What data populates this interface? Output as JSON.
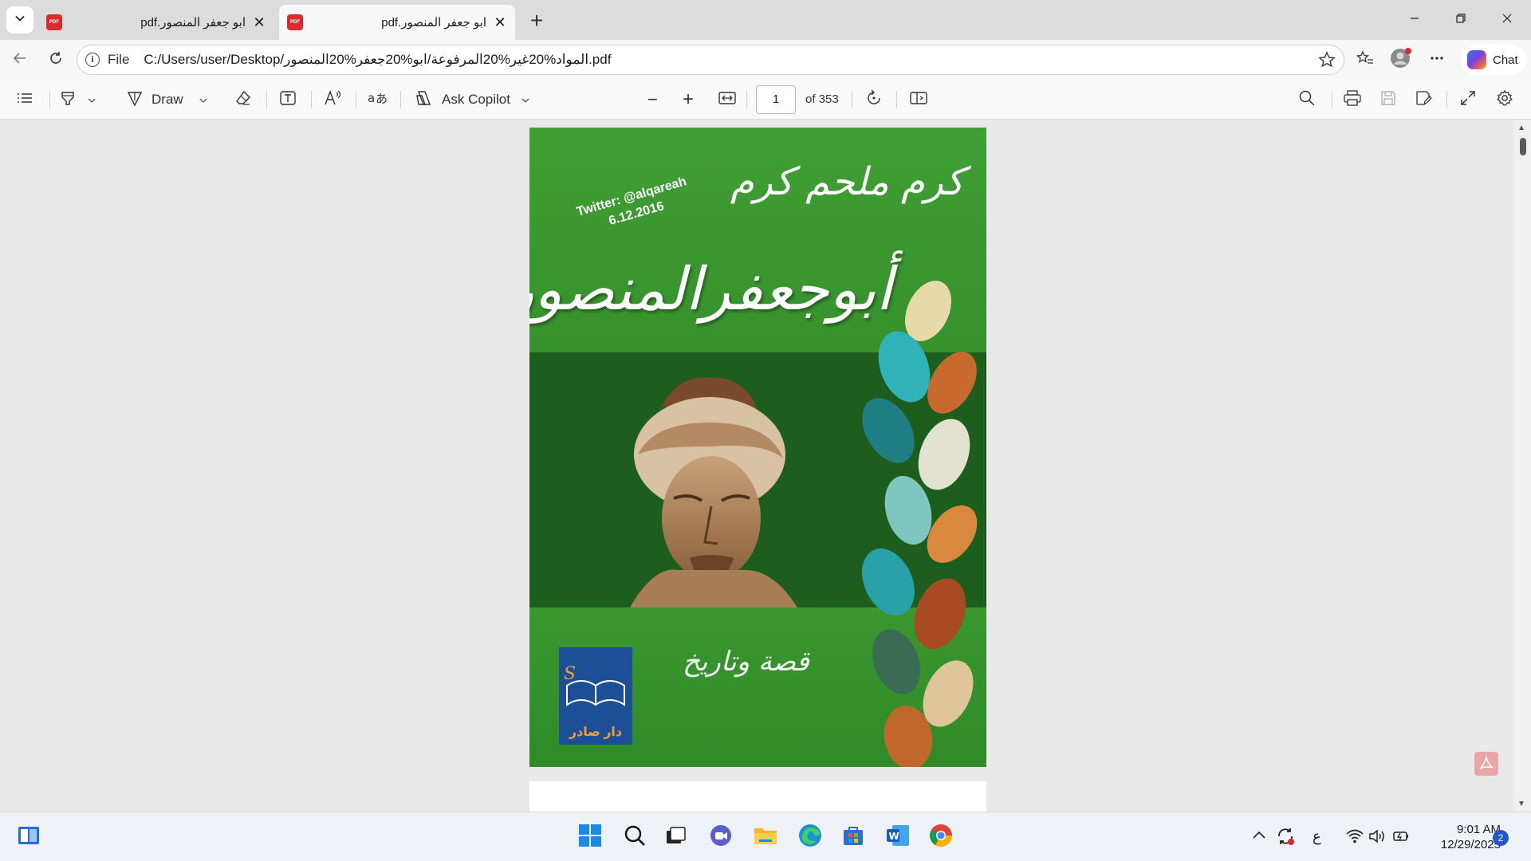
{
  "tabs": [
    {
      "title": "ابو جعفر المنصور.pdf",
      "active": false,
      "icon": "pdf-icon",
      "close": "✕"
    },
    {
      "title": "ابو جعفر المنصور.pdf",
      "active": true,
      "icon": "pdf-icon",
      "close": "✕"
    }
  ],
  "tab_badge_text": "PDF",
  "new_tab_symbol": "+",
  "window_controls": {
    "minimize": "—",
    "restore": "❐",
    "close": "✕"
  },
  "address": {
    "scheme_label": "File",
    "url": "C:/Users/user/Desktop/المواد%20غير%20المرفوعة/ابو%20جعفر%20المنصور.pdf",
    "info_symbol": "i"
  },
  "chat_label": "Chat",
  "pdf_toolbar": {
    "draw_label": "Draw",
    "ask_copilot_label": "Ask Copilot",
    "page_current": "1",
    "page_total_label": "of 353",
    "zoom_out_symbol": "−",
    "zoom_in_symbol": "+"
  },
  "book_cover": {
    "author": "كرم ملحم كرم",
    "twitter_line1": "Twitter: @alqareah",
    "twitter_line2": "6.12.2016",
    "title": "أبوجعفرالمنصور",
    "subtitle": "قصة وتاريخ",
    "publisher": "دار صادر"
  },
  "taskbar": {
    "language_indicator": "ع",
    "time": "9:01 AM",
    "date": "12/29/2025",
    "notification_count": "2"
  },
  "colors": {
    "cover_green": "#3a962f",
    "cover_band_dark": "#1d5e1f",
    "accent_blue": "#1f56c9",
    "pdf_red": "#d92b2b"
  }
}
